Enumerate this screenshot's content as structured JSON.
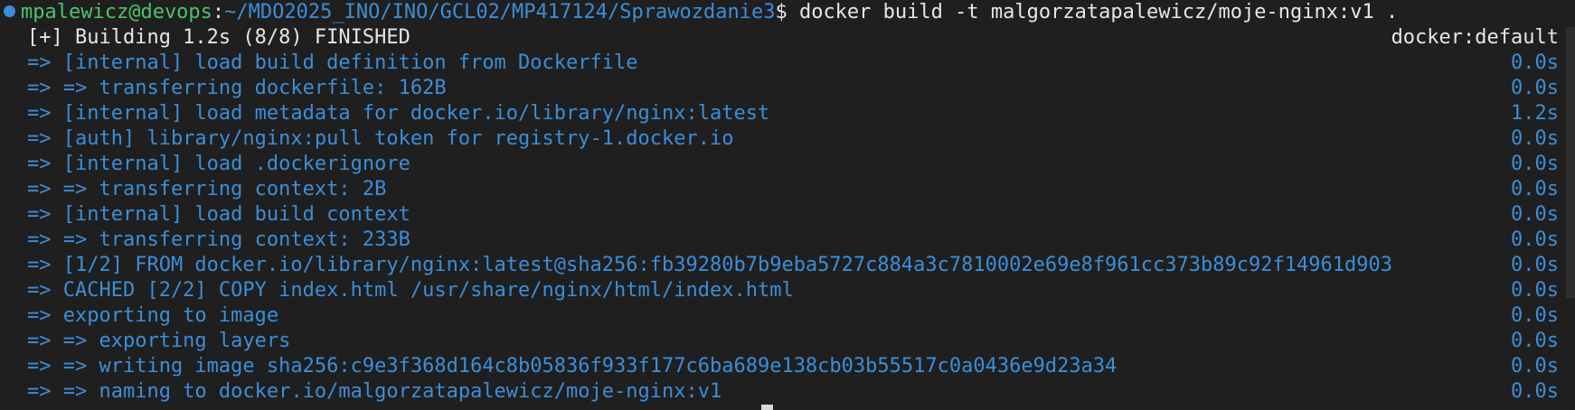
{
  "prompt": {
    "user_host": "mpalewicz@devops",
    "colon": ":",
    "cwd": "~/MDO2025_INO/INO/GCL02/MP417124/Sprawozdanie3",
    "symbol": "$",
    "command": " docker build -t malgorzatapalewicz/moje-nginx:v1 ."
  },
  "header": {
    "status": "[+] Building 1.2s (8/8) FINISHED",
    "context": "docker:default"
  },
  "steps": [
    {
      "text": "=> [internal] load build definition from Dockerfile",
      "time": "0.0s"
    },
    {
      "text": "=> => transferring dockerfile: 162B",
      "time": "0.0s"
    },
    {
      "text": "=> [internal] load metadata for docker.io/library/nginx:latest",
      "time": "1.2s"
    },
    {
      "text": "=> [auth] library/nginx:pull token for registry-1.docker.io",
      "time": "0.0s"
    },
    {
      "text": "=> [internal] load .dockerignore",
      "time": "0.0s"
    },
    {
      "text": "=> => transferring context: 2B",
      "time": "0.0s"
    },
    {
      "text": "=> [internal] load build context",
      "time": "0.0s"
    },
    {
      "text": "=> => transferring context: 233B",
      "time": "0.0s"
    },
    {
      "text": "=> [1/2] FROM docker.io/library/nginx:latest@sha256:fb39280b7b9eba5727c884a3c7810002e69e8f961cc373b89c92f14961d903",
      "time": "0.0s"
    },
    {
      "text": "=> CACHED [2/2] COPY index.html /usr/share/nginx/html/index.html",
      "time": "0.0s"
    },
    {
      "text": "=> exporting to image",
      "time": "0.0s"
    },
    {
      "text": "=> => exporting layers",
      "time": "0.0s"
    },
    {
      "text": "=> => writing image sha256:c9e3f368d164c8b05836f933f177c6ba689e138cb03b55517c0a0436e9d23a34",
      "time": "0.0s"
    },
    {
      "text": "=> => naming to docker.io/malgorzatapalewicz/moje-nginx:v1",
      "time": "0.0s"
    }
  ],
  "colors": {
    "background": "#1f1f1f",
    "prompt_user": "#4ec26a",
    "prompt_path": "#3b8ed8",
    "step_text": "#3b8ed8",
    "default_text": "#e6e6e6"
  }
}
